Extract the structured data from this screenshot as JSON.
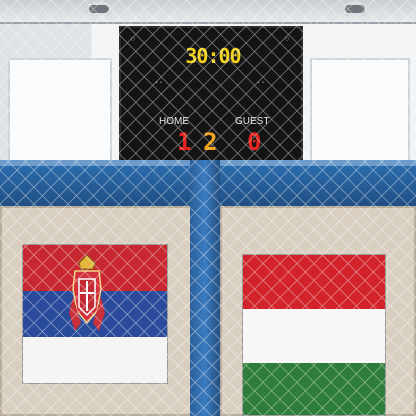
{
  "scoreboard": {
    "clock": "30:00",
    "home_label": "HOME",
    "guest_label": "GUEST",
    "home_score": "1",
    "period": "2",
    "guest_score": "0",
    "clock_color": "#f2d21b",
    "score_color": "#e8231f",
    "period_color": "#f2a31b"
  },
  "flags": {
    "left": {
      "country": "serbia",
      "colors": [
        "#c8272f",
        "#2a4b9b",
        "#f4f4f4"
      ]
    },
    "right": {
      "country": "hungary",
      "colors": [
        "#d2232a",
        "#f7f7f7",
        "#2f7d3a"
      ]
    }
  },
  "colors": {
    "railing": "#2d6fb1",
    "panel": "#d8cfc1"
  }
}
